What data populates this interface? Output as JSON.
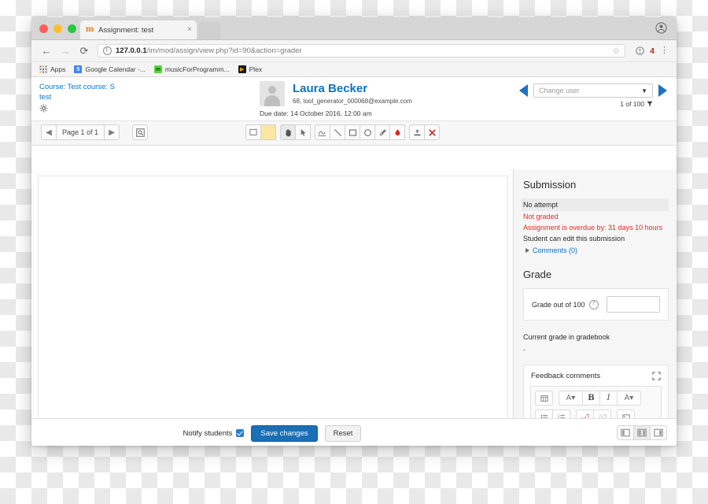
{
  "browser": {
    "tab": {
      "title": "Assignment: test",
      "favicon": "moodle-m-icon",
      "close": "×"
    },
    "nav": {
      "back": "←",
      "forward": "→",
      "reload": "⟳"
    },
    "omnibox": {
      "host": "127.0.0.1",
      "path": "/im/mod/assign/view.php?id=90&action=grader",
      "star": "☆",
      "extension_badge": "4",
      "menu": "⋮"
    },
    "bookmarks": [
      {
        "label": "Apps",
        "icon": "apps-grid-icon",
        "glyph": ""
      },
      {
        "label": "Google Calendar -...",
        "icon": "google-calendar-icon",
        "glyph": "5"
      },
      {
        "label": "musicForProgramm...",
        "icon": "music-for-programming-icon",
        "glyph": "m"
      },
      {
        "label": "Plex",
        "icon": "plex-icon",
        "glyph": "▶"
      }
    ]
  },
  "header": {
    "course_line1": "Course: Test course: S",
    "course_line2": "test",
    "settings_icon": "gear-icon",
    "user": {
      "name": "Laura Becker",
      "email": "68, tool_generator_000068@example.com",
      "avatar": "user-avatar-placeholder"
    },
    "due_date": "Due date: 14 October 2016, 12:00 am",
    "user_nav": {
      "prev": "previous-user-arrow",
      "next": "next-user-arrow",
      "select_placeholder": "Change user",
      "caret": "▼",
      "counter": "1 of 100",
      "filter_icon": "funnel-icon"
    }
  },
  "toolbar": {
    "pager": {
      "prev": "◀",
      "label": "Page 1 of 1",
      "next": "▶"
    },
    "search_icon": "search-page-icon",
    "tools": [
      {
        "name": "comment-tool",
        "glyph": "▣"
      },
      {
        "name": "highlight-color-swatch",
        "glyph": ""
      },
      {
        "name": "pan-tool",
        "glyph": "✋"
      },
      {
        "name": "select-tool",
        "glyph": "➤"
      },
      {
        "name": "pen-tool",
        "glyph": "✎"
      },
      {
        "name": "line-tool",
        "glyph": "╲"
      },
      {
        "name": "rectangle-tool",
        "glyph": "□"
      },
      {
        "name": "ellipse-tool",
        "glyph": "○"
      },
      {
        "name": "highlighter-tool",
        "glyph": "✐"
      },
      {
        "name": "color-picker-tool",
        "glyph": "◆"
      },
      {
        "name": "stamp-tool",
        "glyph": "⤓"
      },
      {
        "name": "delete-annotation-tool",
        "glyph": "✕"
      }
    ]
  },
  "submission": {
    "title": "Submission",
    "attempt_status": "No attempt",
    "grading_status": "Not graded",
    "overdue": "Assignment is overdue by: 31 days 10 hours",
    "editable": "Student can edit this submission",
    "comments": "Comments (0)"
  },
  "grade": {
    "title": "Grade",
    "label": "Grade out of 100",
    "help_icon": "help-icon",
    "value": "",
    "current_label": "Current grade in gradebook",
    "current_value": "-"
  },
  "feedback": {
    "title": "Feedback comments",
    "expand_icon": "expand-icon",
    "editor_row1": [
      {
        "name": "html-source-button",
        "glyph": "▦"
      },
      {
        "name": "paragraph-style-button",
        "glyph": "A▾"
      },
      {
        "name": "bold-button",
        "glyph": "B"
      },
      {
        "name": "italic-button",
        "glyph": "I"
      },
      {
        "name": "font-color-button",
        "glyph": "A▾"
      }
    ],
    "editor_row2": [
      {
        "name": "bullet-list-button",
        "glyph": "≡"
      },
      {
        "name": "numbered-list-button",
        "glyph": "≣"
      },
      {
        "name": "link-button",
        "glyph": "🔗"
      },
      {
        "name": "unlink-button",
        "glyph": "✂"
      },
      {
        "name": "image-button",
        "glyph": "❑"
      }
    ],
    "body_value": ""
  },
  "footer": {
    "notify_label": "Notify students",
    "notify_checked": true,
    "save_label": "Save changes",
    "reset_label": "Reset",
    "layout_buttons": [
      {
        "name": "layout-collapse-left",
        "active": false
      },
      {
        "name": "layout-both-panels",
        "active": true
      },
      {
        "name": "layout-collapse-right",
        "active": false
      }
    ]
  },
  "colors": {
    "link": "#0b74c4",
    "danger": "#e22b26",
    "primary_button": "#1a6fb5",
    "arrow_blue": "#1e73be",
    "highlight_swatch": "#fbe7a1"
  }
}
